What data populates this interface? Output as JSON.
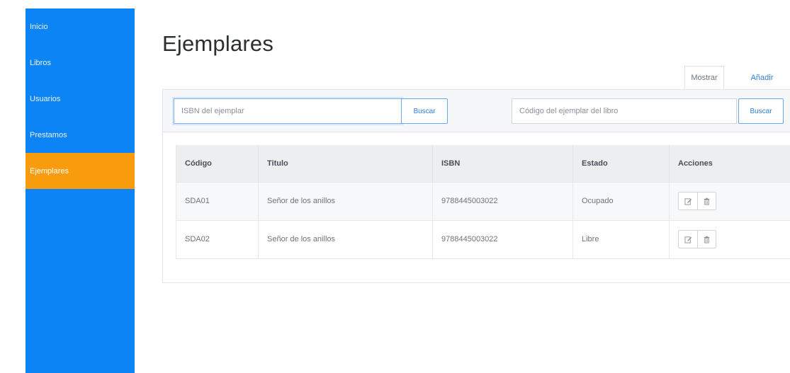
{
  "sidebar": {
    "items": [
      {
        "label": "Inicio"
      },
      {
        "label": "Libros"
      },
      {
        "label": "Usuarios"
      },
      {
        "label": "Prestamos"
      },
      {
        "label": "Ejemplares"
      }
    ],
    "active_color": "#f89c0e",
    "background_color": "#0d84f5"
  },
  "header": {
    "title": "Ejemplares"
  },
  "tabs": [
    {
      "label": "Mostrar"
    },
    {
      "label": "Añadir"
    }
  ],
  "search": {
    "isbn_placeholder": "ISBN del ejemplar",
    "isbn_button": "Buscar",
    "code_placeholder": "Código del ejemplar del libro",
    "code_button": "Buscar"
  },
  "table": {
    "columns": [
      "Código",
      "Titulo",
      "ISBN",
      "Estado",
      "Acciones"
    ],
    "rows": [
      {
        "codigo": "SDA01",
        "titulo": "Señor de los anillos",
        "isbn": "9788445003022",
        "estado": "Ocupado"
      },
      {
        "codigo": "SDA02",
        "titulo": "Señor de los anillos",
        "isbn": "9788445003022",
        "estado": "Libre"
      }
    ],
    "row_actions": [
      "edit-icon",
      "trash-icon"
    ]
  }
}
